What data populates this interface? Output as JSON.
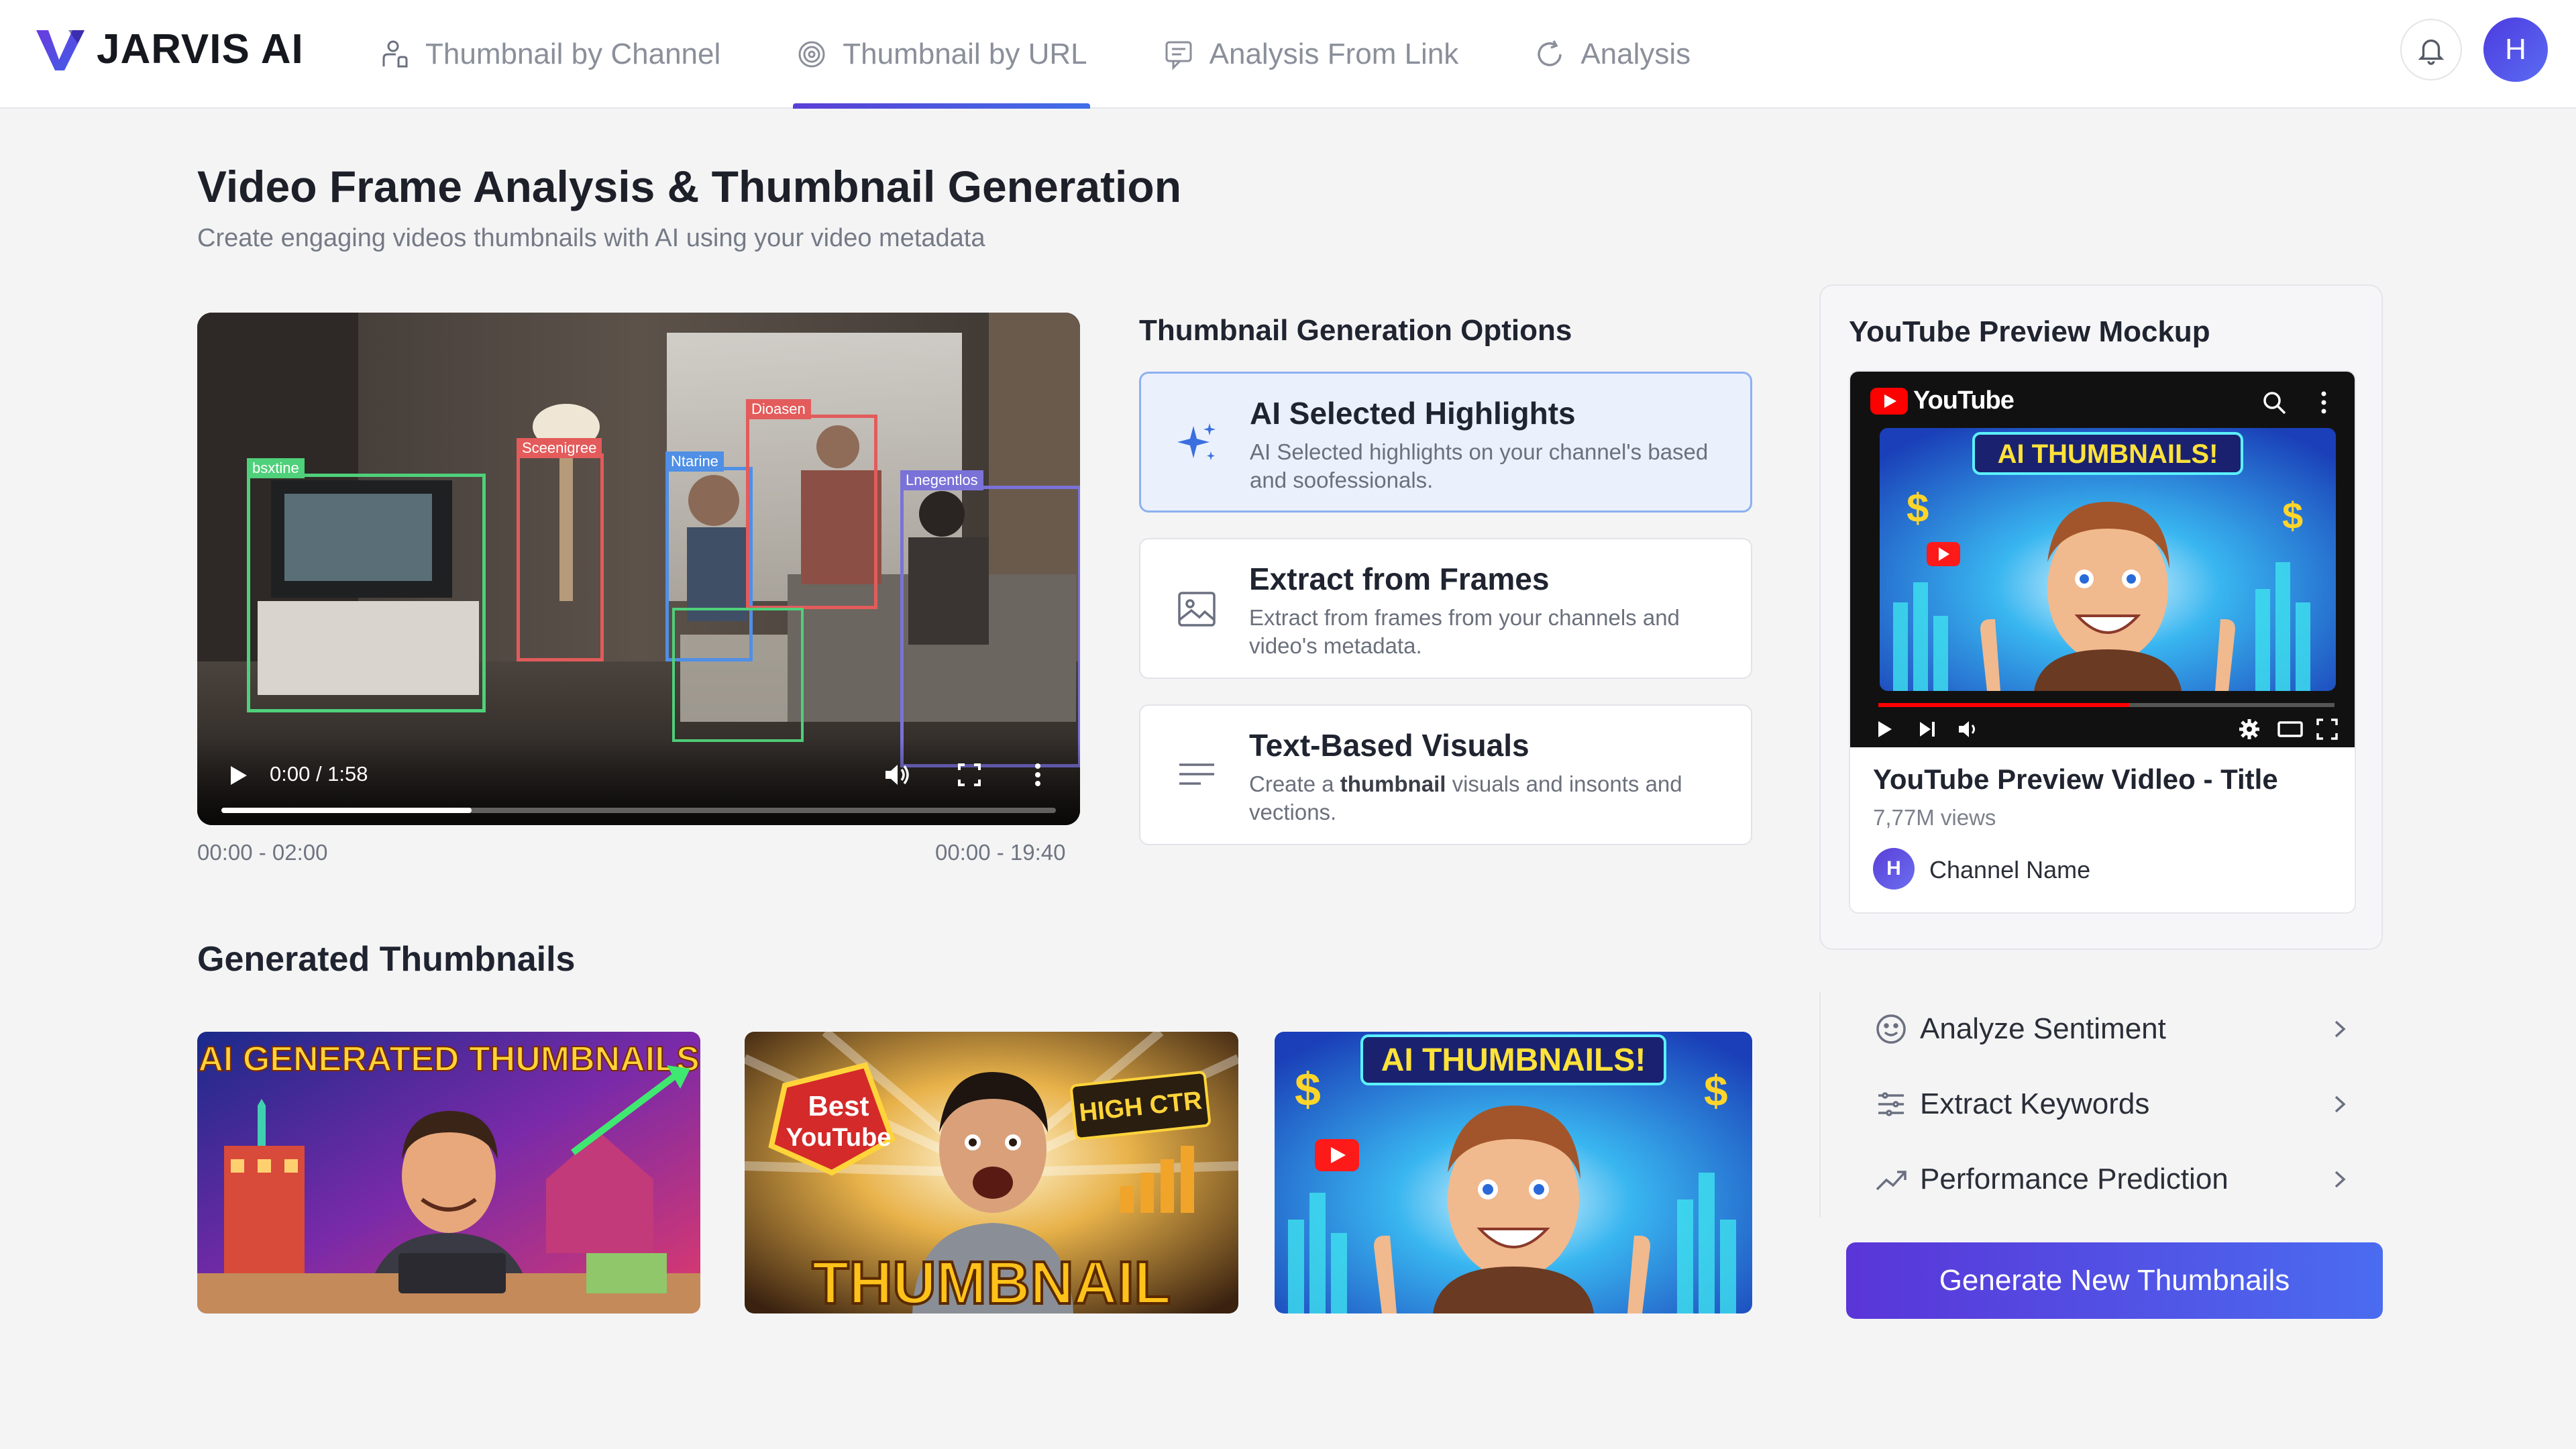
{
  "brand": {
    "name": "JARVIS AI"
  },
  "nav": {
    "tabs": [
      {
        "label": "Thumbnail by Channel",
        "icon": "user-hand-icon"
      },
      {
        "label": "Thumbnail by URL",
        "icon": "target-icon"
      },
      {
        "label": "Analysis From Link",
        "icon": "chat-icon"
      },
      {
        "label": "Analysis",
        "icon": "refresh-icon"
      }
    ],
    "active_index": 1,
    "user_initial": "H"
  },
  "page": {
    "title": "Video Frame Analysis & Thumbnail Generation",
    "subtitle": "Create engaging videos thumbnails with AI using your video metadata"
  },
  "video": {
    "time_display": "0:00 / 1:58",
    "progress": 0.3,
    "range_left": "00:00 - 02:00",
    "range_right": "00:00 - 19:40",
    "detections": [
      "bsxtine",
      "Sceenigree",
      "Ntarine",
      "Dioasen",
      "Lnegentlos"
    ]
  },
  "options": {
    "title": "Thumbnail Generation Options",
    "items": [
      {
        "title": "AI Selected Highlights",
        "desc": "AI Selected highlights on your channel's based and soofessionals.",
        "icon": "sparkle-icon",
        "selected": true
      },
      {
        "title": "Extract from Frames",
        "desc": "Extract from frames from your channels and video's metadata.",
        "icon": "image-icon",
        "selected": false
      },
      {
        "title": "Text-Based Visuals",
        "desc_prefix": "Create a ",
        "desc_bold": "thumbnail",
        "desc_suffix": " visuals and insonts and vections.",
        "icon": "text-lines-icon",
        "selected": false
      }
    ]
  },
  "youtube": {
    "panel_title": "YouTube Preview Mockup",
    "logo_text": "YouTube",
    "thumbnail_text": "AI THUMBNAILS!",
    "progress": 0.55,
    "video_title": "YouTube Preview Vidleo - Title",
    "views": "7,77M views",
    "channel_initial": "H",
    "channel_name": "Channel Name"
  },
  "actions": {
    "items": [
      {
        "label": "Analyze Sentiment",
        "icon": "smile-icon"
      },
      {
        "label": "Extract Keywords",
        "icon": "sliders-icon"
      },
      {
        "label": "Performance Prediction",
        "icon": "trend-icon"
      }
    ],
    "generate_label": "Generate New Thumbnails"
  },
  "generated": {
    "title": "Generated Thumbnails",
    "thumbs": [
      {
        "text": "AI GENERATED THUMBNAILS"
      },
      {
        "badge_line1": "Best",
        "badge_line2": "YouTube",
        "tag": "HIGH CTR",
        "text": "THUMBNAIL"
      },
      {
        "text": "AI THUMBNAILS!"
      }
    ]
  },
  "colors": {
    "accent": "#4f46e5",
    "accent_blue": "#3f6fe6",
    "selected_bg": "#eaf1fd",
    "youtube_red": "#ff0000"
  }
}
